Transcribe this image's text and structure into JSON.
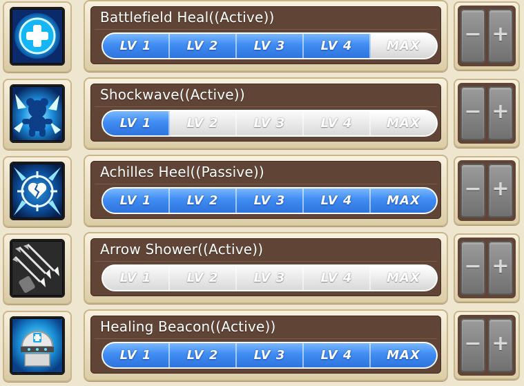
{
  "skills": [
    {
      "name": "Battlefield Heal((Active))",
      "icon": "medical-cross-icon",
      "level_labels": [
        "LV 1",
        "LV 2",
        "LV 3",
        "LV 4",
        "MAX"
      ],
      "level_active": [
        true,
        true,
        true,
        true,
        false
      ],
      "minus_label": "−",
      "plus_label": "+"
    },
    {
      "name": "Shockwave((Active))",
      "icon": "shockwave-icon",
      "level_labels": [
        "LV 1",
        "LV 2",
        "LV 3",
        "LV 4",
        "MAX"
      ],
      "level_active": [
        true,
        false,
        false,
        false,
        false
      ],
      "minus_label": "−",
      "plus_label": "+"
    },
    {
      "name": "Achilles Heel((Passive))",
      "icon": "broken-heart-target-icon",
      "level_labels": [
        "LV 1",
        "LV 2",
        "LV 3",
        "LV 4",
        "MAX"
      ],
      "level_active": [
        true,
        true,
        true,
        true,
        true
      ],
      "minus_label": "−",
      "plus_label": "+"
    },
    {
      "name": "Arrow Shower((Active))",
      "icon": "arrows-icon",
      "level_labels": [
        "LV 1",
        "LV 2",
        "LV 3",
        "LV 4",
        "MAX"
      ],
      "level_active": [
        false,
        false,
        false,
        false,
        false
      ],
      "minus_label": "−",
      "plus_label": "+"
    },
    {
      "name": "Healing Beacon((Active))",
      "icon": "healing-beacon-icon",
      "level_labels": [
        "LV 1",
        "LV 2",
        "LV 3",
        "LV 4",
        "MAX"
      ],
      "level_active": [
        true,
        true,
        true,
        true,
        true
      ],
      "minus_label": "−",
      "plus_label": "+"
    }
  ],
  "colors": {
    "level_on": "#3f8cf3",
    "level_off": "#e8e8e8",
    "panel_dark": "#604536",
    "frame": "#dccca6"
  }
}
